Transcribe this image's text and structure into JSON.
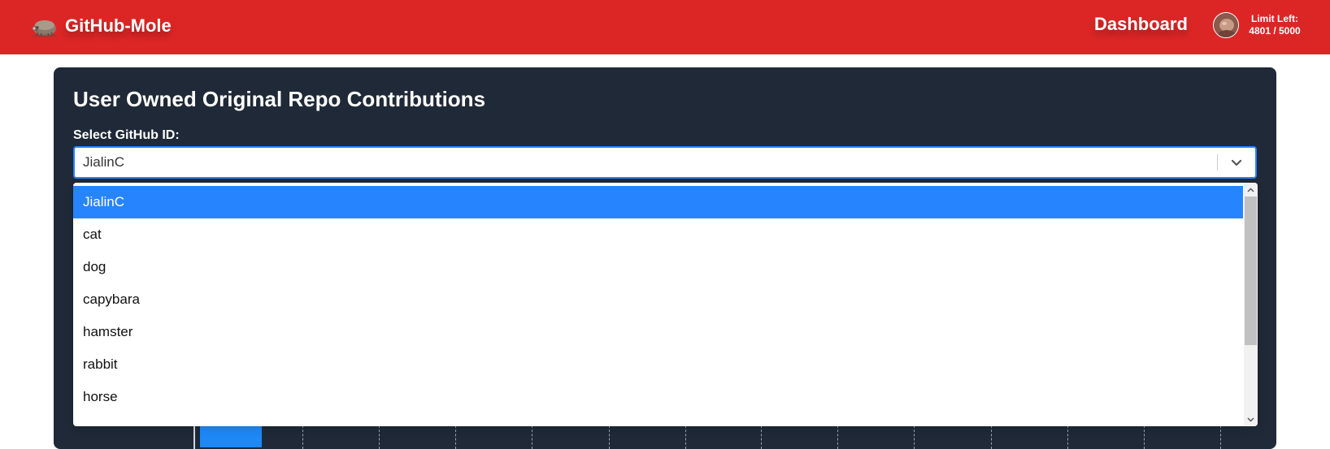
{
  "header": {
    "brand_name": "GitHub-Mole",
    "nav_dashboard": "Dashboard",
    "limit_label": "Limit Left:",
    "limit_value": "4801 / 5000",
    "brand_color": "#dc2626"
  },
  "panel": {
    "title": "User Owned Original Repo Contributions",
    "select_label": "Select GitHub ID:",
    "select_value": "JialinC",
    "options": [
      "JialinC",
      "cat",
      "dog",
      "capybara",
      "hamster",
      "rabbit",
      "horse"
    ],
    "selected_option": "JialinC",
    "panel_color": "#1f2937",
    "accent_color": "#2684ff"
  },
  "icons": {
    "brand": "mole-icon",
    "select": "chevron-down-icon",
    "scroll_up": "scroll-up-arrow-icon",
    "scroll_down": "scroll-down-arrow-icon"
  }
}
